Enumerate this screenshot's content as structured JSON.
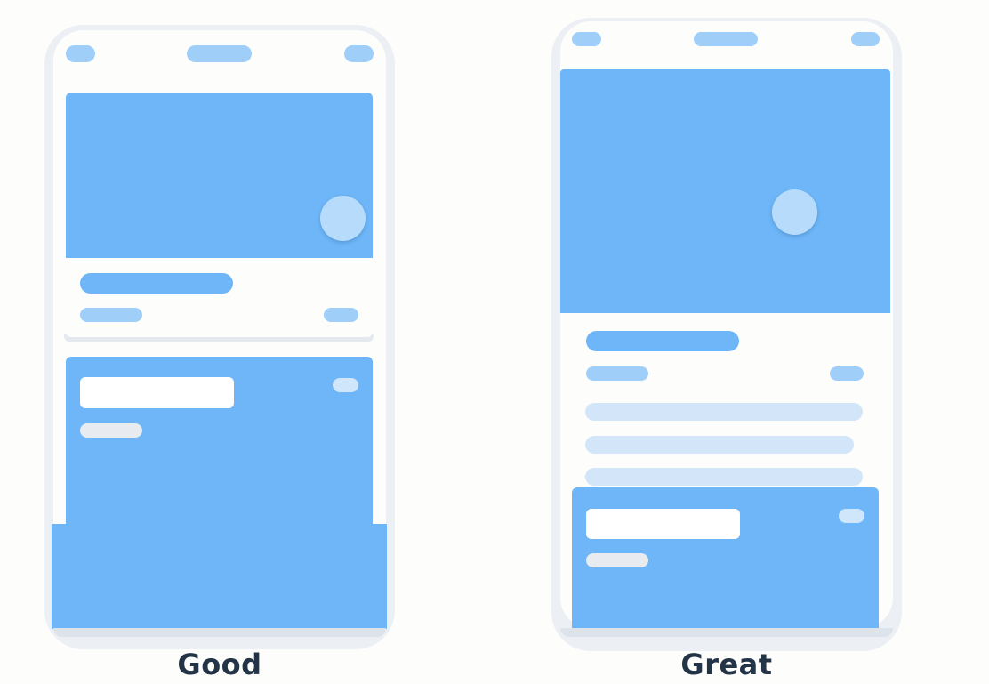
{
  "labels": {
    "left": "Good",
    "right": "Great"
  },
  "colors": {
    "background": "#fdfdfc",
    "phone_frame": "#eceff3",
    "primary_blue": "#6eb6f7",
    "light_blue": "#9fcff9",
    "pale_blue": "#d3e6f9",
    "fab": "#b7dcfb",
    "label_text": "#243447"
  }
}
